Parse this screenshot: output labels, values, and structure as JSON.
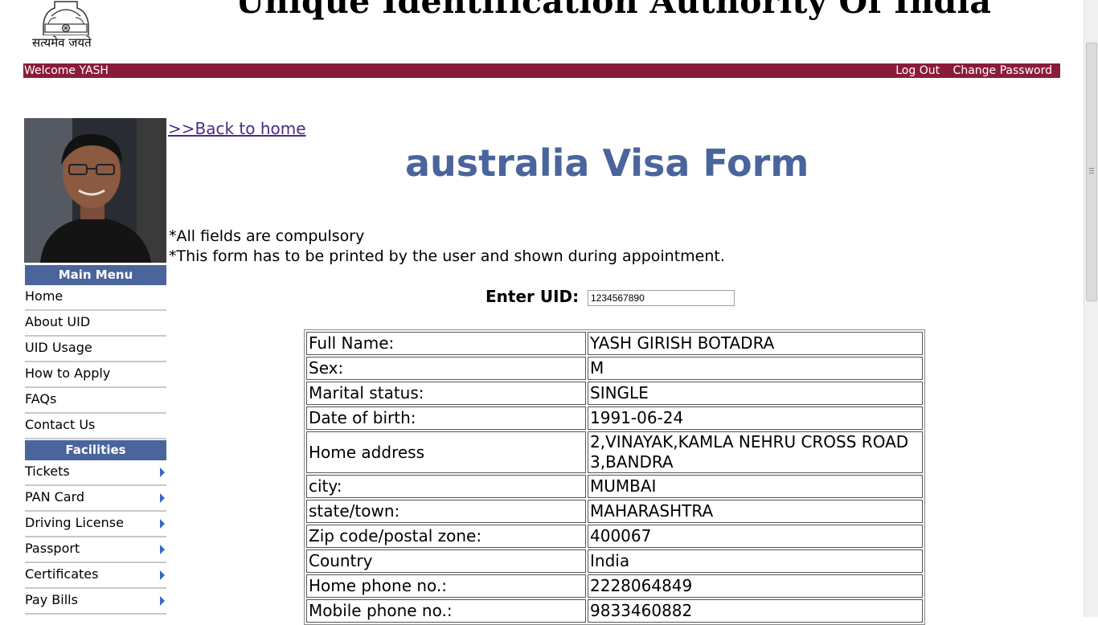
{
  "header": {
    "motto": "सत्यमेव जयते",
    "site_title": "Unique Identification Authority Of India"
  },
  "topbar": {
    "welcome": "Welcome YASH",
    "logout": "Log Out",
    "change_password": "Change Password"
  },
  "sidebar": {
    "main_menu_title": "Main Menu",
    "main_menu": [
      "Home",
      "About UID",
      "UID Usage",
      "How to Apply",
      "FAQs",
      "Contact Us"
    ],
    "facilities_title": "Facilities",
    "facilities": [
      "Tickets",
      "PAN Card",
      "Driving License",
      "Passport",
      "Certificates",
      "Pay Bills"
    ]
  },
  "main": {
    "back_link": ">>Back to home",
    "title": "australia Visa Form",
    "notes": [
      "*All fields are compulsory",
      "*This form has to be printed by the user and shown during appointment."
    ],
    "uid_label": "Enter UID:",
    "uid_value": "1234567890"
  },
  "details": [
    {
      "label": "Full Name:",
      "value": "YASH GIRISH BOTADRA"
    },
    {
      "label": "Sex:",
      "value": "M"
    },
    {
      "label": "Marital status:",
      "value": "SINGLE"
    },
    {
      "label": "Date of birth:",
      "value": "1991-06-24"
    },
    {
      "label": "Home address",
      "value": "2,VINAYAK,KAMLA NEHRU CROSS ROAD",
      "value2": "3,BANDRA"
    },
    {
      "label": "city:",
      "value": "MUMBAI"
    },
    {
      "label": "state/town:",
      "value": "MAHARASHTRA"
    },
    {
      "label": "Zip code/postal zone:",
      "value": "400067"
    },
    {
      "label": "Country",
      "value": "India"
    },
    {
      "label": "Home phone no.:",
      "value": "2228064849"
    },
    {
      "label": "Mobile phone no.:",
      "value": "9833460882"
    }
  ],
  "colors": {
    "topbar": "#8a1c3a",
    "menu_header": "#4a649c",
    "title": "#4a649c",
    "link": "#4b2a86"
  }
}
